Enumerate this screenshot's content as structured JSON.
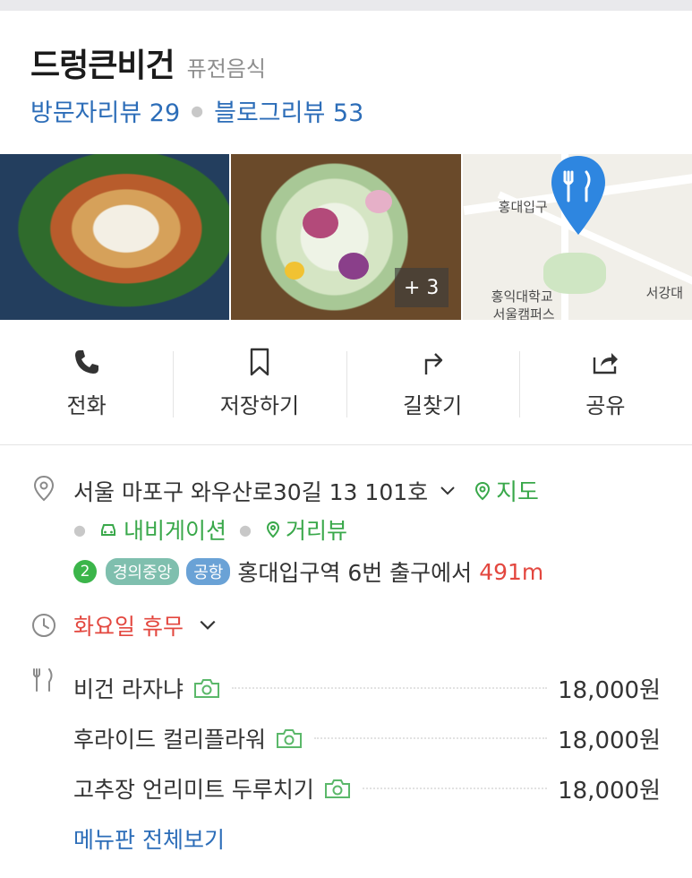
{
  "place": {
    "name": "드렁큰비건",
    "category": "퓨전음식"
  },
  "reviews": {
    "visitor_label": "방문자리뷰",
    "visitor_count": "29",
    "blog_label": "블로그리뷰",
    "blog_count": "53"
  },
  "photos": {
    "more_label": "+ 3",
    "map_labels": [
      "홍대입구",
      "홍익대학교",
      "서울캠퍼스",
      "서강대"
    ]
  },
  "actions": [
    {
      "label": "전화",
      "icon": "phone-icon"
    },
    {
      "label": "저장하기",
      "icon": "bookmark-icon"
    },
    {
      "label": "길찾기",
      "icon": "directions-icon"
    },
    {
      "label": "공유",
      "icon": "share-icon"
    }
  ],
  "address": {
    "text": "서울 마포구 와우산로30길 13 101호",
    "map_link": "지도",
    "navigation_link": "내비게이션",
    "street_view_link": "거리뷰"
  },
  "subway": {
    "line_number": "2",
    "line_badges": [
      "경의중앙",
      "공항"
    ],
    "station_text": "홍대입구역 6번 출구에서",
    "distance": "491m"
  },
  "hours": {
    "text": "화요일 휴무"
  },
  "menu": {
    "items": [
      {
        "name": "비건 라자냐",
        "price": "18,000원"
      },
      {
        "name": "후라이드 컬리플라워",
        "price": "18,000원"
      },
      {
        "name": "고추장 언리미트 두루치기",
        "price": "18,000원"
      }
    ],
    "view_all": "메뉴판 전체보기"
  },
  "colors": {
    "link_blue": "#2c6db8",
    "green": "#39a84a",
    "red": "#e3473f",
    "line2_green": "#3bb54a",
    "gyeongui_teal": "#7fbfae",
    "airport_blue": "#6aa2d6"
  }
}
